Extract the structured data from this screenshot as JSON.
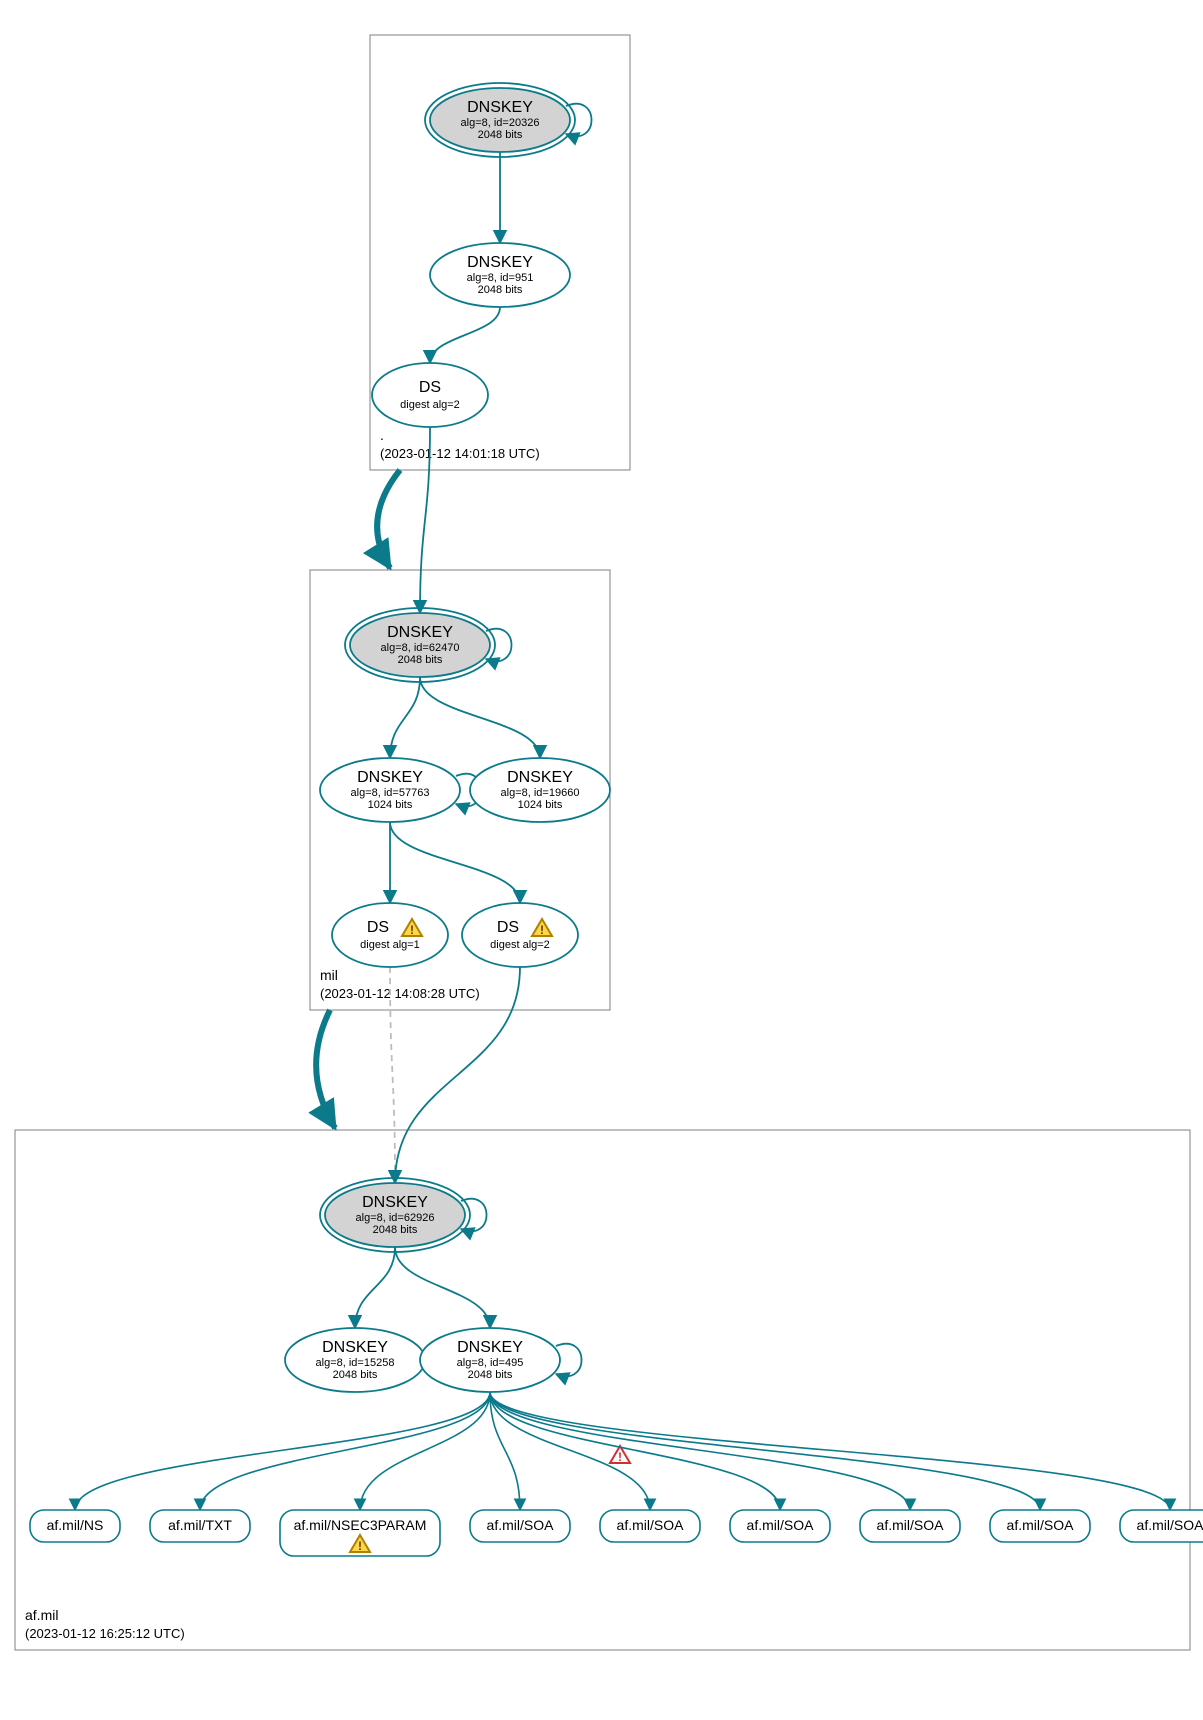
{
  "chart_data": {
    "type": "tree",
    "zones": [
      {
        "name": ".",
        "timestamp": "(2023-01-12 14:01:18 UTC)"
      },
      {
        "name": "mil",
        "timestamp": "(2023-01-12 14:08:28 UTC)"
      },
      {
        "name": "af.mil",
        "timestamp": "(2023-01-12 16:25:12 UTC)"
      }
    ],
    "nodes": {
      "root_ksk": {
        "zone": ".",
        "type": "DNSKEY",
        "alg": "alg=8, id=20326",
        "bits": "2048 bits",
        "ksk": true,
        "selfloop": true
      },
      "root_zsk": {
        "zone": ".",
        "type": "DNSKEY",
        "alg": "alg=8, id=951",
        "bits": "2048 bits"
      },
      "root_ds": {
        "zone": ".",
        "type": "DS",
        "sub": "digest alg=2"
      },
      "mil_ksk": {
        "zone": "mil",
        "type": "DNSKEY",
        "alg": "alg=8, id=62470",
        "bits": "2048 bits",
        "ksk": true,
        "selfloop": true
      },
      "mil_zsk1": {
        "zone": "mil",
        "type": "DNSKEY",
        "alg": "alg=8, id=57763",
        "bits": "1024 bits",
        "selfloop": true
      },
      "mil_zsk2": {
        "zone": "mil",
        "type": "DNSKEY",
        "alg": "alg=8, id=19660",
        "bits": "1024 bits"
      },
      "mil_ds1": {
        "zone": "mil",
        "type": "DS",
        "sub": "digest alg=1",
        "warn": true
      },
      "mil_ds2": {
        "zone": "mil",
        "type": "DS",
        "sub": "digest alg=2",
        "warn": true
      },
      "af_ksk": {
        "zone": "af.mil",
        "type": "DNSKEY",
        "alg": "alg=8, id=62926",
        "bits": "2048 bits",
        "ksk": true,
        "selfloop": true
      },
      "af_zsk1": {
        "zone": "af.mil",
        "type": "DNSKEY",
        "alg": "alg=8, id=15258",
        "bits": "2048 bits"
      },
      "af_zsk2": {
        "zone": "af.mil",
        "type": "DNSKEY",
        "alg": "alg=8, id=495",
        "bits": "2048 bits",
        "selfloop": true
      }
    },
    "rrsets": [
      {
        "label": "af.mil/NS"
      },
      {
        "label": "af.mil/TXT"
      },
      {
        "label": "af.mil/NSEC3PARAM",
        "warn": true
      },
      {
        "label": "af.mil/SOA"
      },
      {
        "label": "af.mil/SOA",
        "edge_warn": true
      },
      {
        "label": "af.mil/SOA"
      },
      {
        "label": "af.mil/SOA"
      },
      {
        "label": "af.mil/SOA"
      },
      {
        "label": "af.mil/SOA"
      }
    ],
    "edges": [
      [
        "root_ksk",
        "root_zsk"
      ],
      [
        "root_zsk",
        "root_ds"
      ],
      [
        "root_ds",
        "mil_ksk"
      ],
      [
        "mil_ksk",
        "mil_zsk1"
      ],
      [
        "mil_ksk",
        "mil_zsk2"
      ],
      [
        "mil_zsk1",
        "mil_ds1"
      ],
      [
        "mil_zsk1",
        "mil_ds2"
      ],
      [
        "mil_ds1",
        "af_ksk",
        "dashed"
      ],
      [
        "mil_ds2",
        "af_ksk"
      ],
      [
        "af_ksk",
        "af_zsk1"
      ],
      [
        "af_ksk",
        "af_zsk2"
      ]
    ]
  },
  "colors": {
    "teal": "#0b7a8b",
    "grey": "#d3d3d3",
    "border": "#808080"
  }
}
